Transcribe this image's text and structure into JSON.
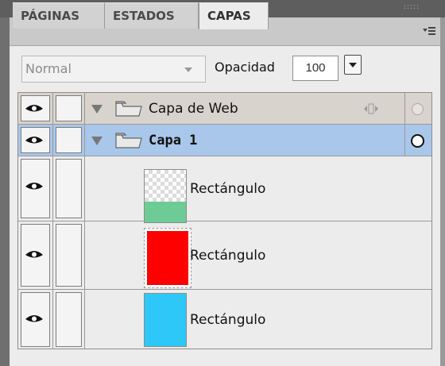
{
  "panel": {
    "tabs": [
      {
        "label": "PÁGINAS",
        "active": false
      },
      {
        "label": "ESTADOS",
        "active": false
      },
      {
        "label": "CAPAS",
        "active": true
      }
    ],
    "grip_text": ":::::"
  },
  "options": {
    "blend_mode": "Normal",
    "opacity_label": "Opacidad",
    "opacity_value": "100"
  },
  "layers": [
    {
      "name": "Capa de Web",
      "type": "folder",
      "expanded": true,
      "visible": true,
      "selected": false,
      "bold": false
    },
    {
      "name": "Capa 1",
      "type": "folder",
      "expanded": true,
      "visible": true,
      "selected": true,
      "bold": true
    },
    {
      "name": "Rectángulo",
      "type": "shape",
      "visible": true,
      "thumb_color": "#6dcb96",
      "thumb_fill": 0.4
    },
    {
      "name": "Rectángulo",
      "type": "shape",
      "visible": true,
      "thumb_color": "#ff0000",
      "thumb_fill": 1.0
    },
    {
      "name": "Rectángulo",
      "type": "shape",
      "visible": true,
      "thumb_color": "#2ec8f8",
      "thumb_fill": 1.0
    }
  ],
  "colors": {
    "selected_row": "#a9c7ea",
    "web_layer_row": "#d8d3cc"
  }
}
